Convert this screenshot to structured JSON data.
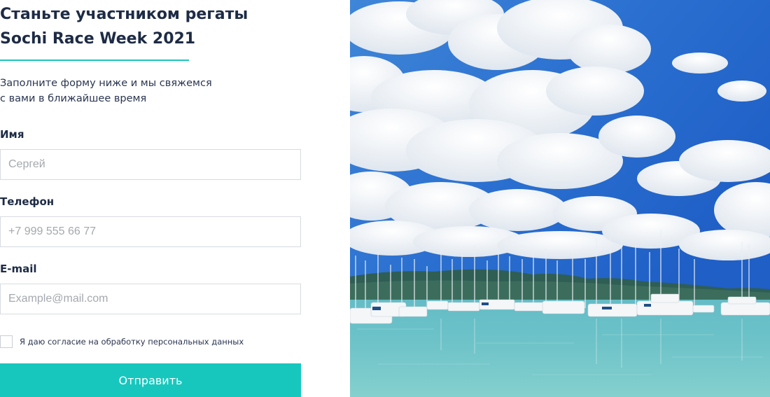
{
  "form": {
    "title": "Станьте участником регаты\nSochi Race Week 2021",
    "subtitle": "Заполните форму ниже и мы свяжемся\nс вами в ближайшее время",
    "name": {
      "label": "Имя",
      "placeholder": "Сергей"
    },
    "phone": {
      "label": "Телефон",
      "placeholder": "+7 999 555 66 77"
    },
    "email": {
      "label": "E-mail",
      "placeholder": "Example@mail.com"
    },
    "consent_label": "Я даю согласие на обработку персональных данных",
    "consent_checked": false,
    "submit_label": "Отправить"
  },
  "colors": {
    "accent": "#1ec4bb",
    "heading": "#1d2b45"
  },
  "photo": {
    "subject": "marina-with-sailboats"
  }
}
